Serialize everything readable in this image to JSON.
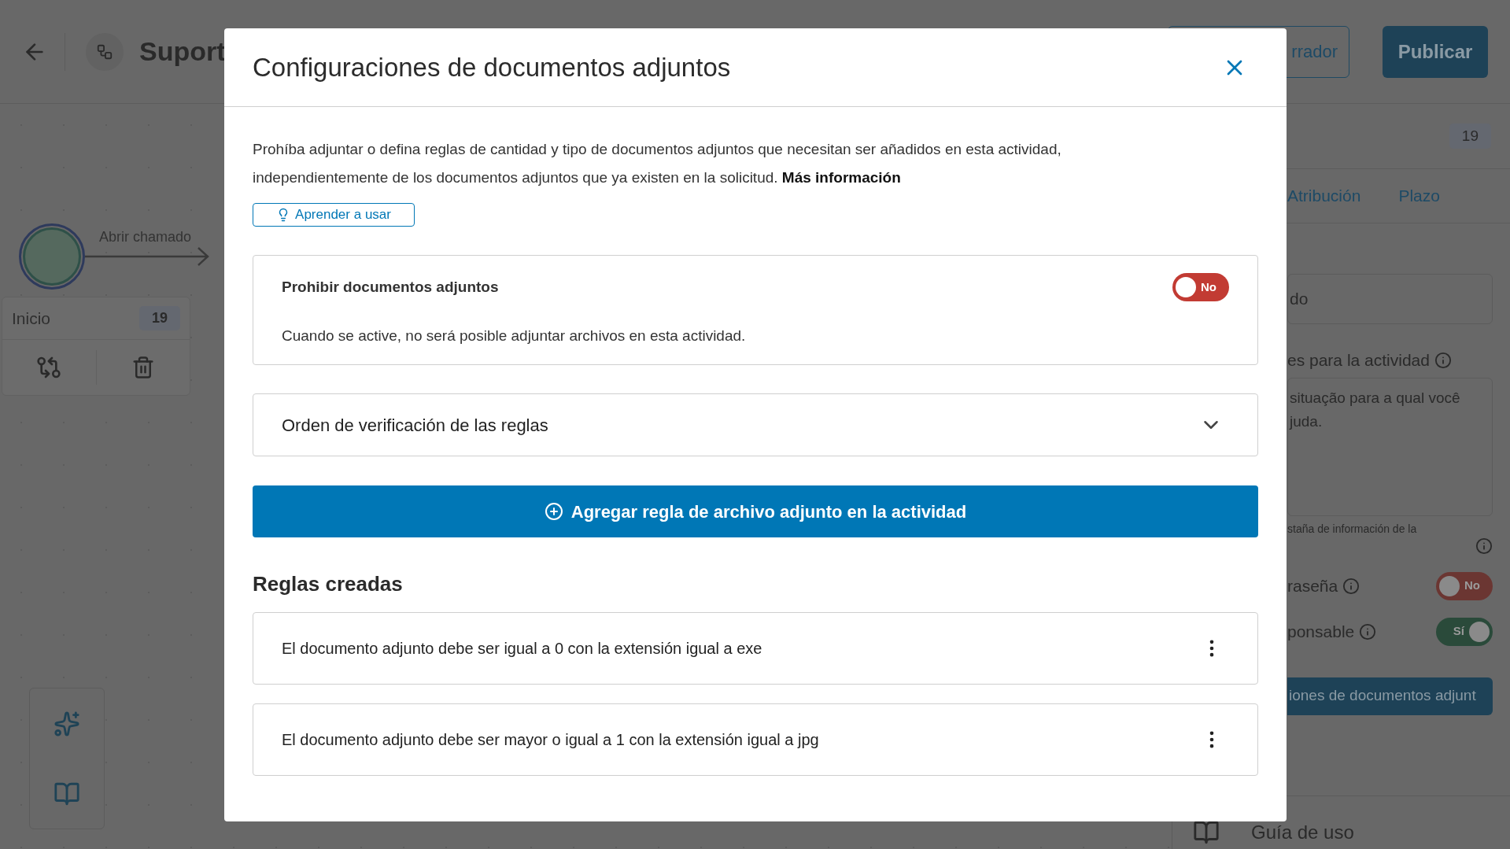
{
  "topbar": {
    "title": "Suport",
    "buttons": [
      {
        "kind": "outline",
        "label": "rrador"
      },
      {
        "kind": "primary",
        "label": "Publicar"
      }
    ]
  },
  "canvas": {
    "start_label": "Abrir chamado",
    "node": {
      "title": "Inicio",
      "badge": "19"
    }
  },
  "side_panel": {
    "badge": "19",
    "tabs": [
      {
        "label": "Atribución",
        "selected": false
      },
      {
        "label": "Plazo",
        "selected": false
      }
    ],
    "name_field": {
      "value": "do"
    },
    "description_label": "es para la actividad",
    "description_field": {
      "value": "situação para a qual você\njuda."
    },
    "hint": "staña de información de la",
    "switches": [
      {
        "label": "raseña",
        "on": false,
        "state_text": "No"
      },
      {
        "label": "ponsable",
        "on": true,
        "state_text": "Sí"
      }
    ],
    "attachments_button": "iones de documentos adjunt",
    "guide": "Guía de uso"
  },
  "dialog": {
    "title": "Configuraciones de documentos adjuntos",
    "description": "Prohíba adjuntar o defina reglas de cantidad y tipo de documentos adjuntos que necesitan ser añadidos en esta actividad, independientemente de los documentos adjuntos que ya existen en la solicitud.",
    "more_link": "Más información",
    "learn_button": "Aprender a usar",
    "prohibit": {
      "title": "Prohibir documentos adjuntos",
      "description": "Cuando se active, no será posible adjuntar archivos en esta actividad.",
      "on": false,
      "state_text": "No"
    },
    "accordion": {
      "title": "Orden de verificación de las reglas",
      "expanded": false
    },
    "add_button": "Agregar regla de archivo adjunto en la actividad",
    "rules_heading": "Reglas creadas",
    "rules": [
      "El documento adjunto debe ser igual a 0 con la extensión igual a exe",
      "El documento adjunto debe ser mayor o igual a 1 con la extensión igual a jpg"
    ]
  }
}
